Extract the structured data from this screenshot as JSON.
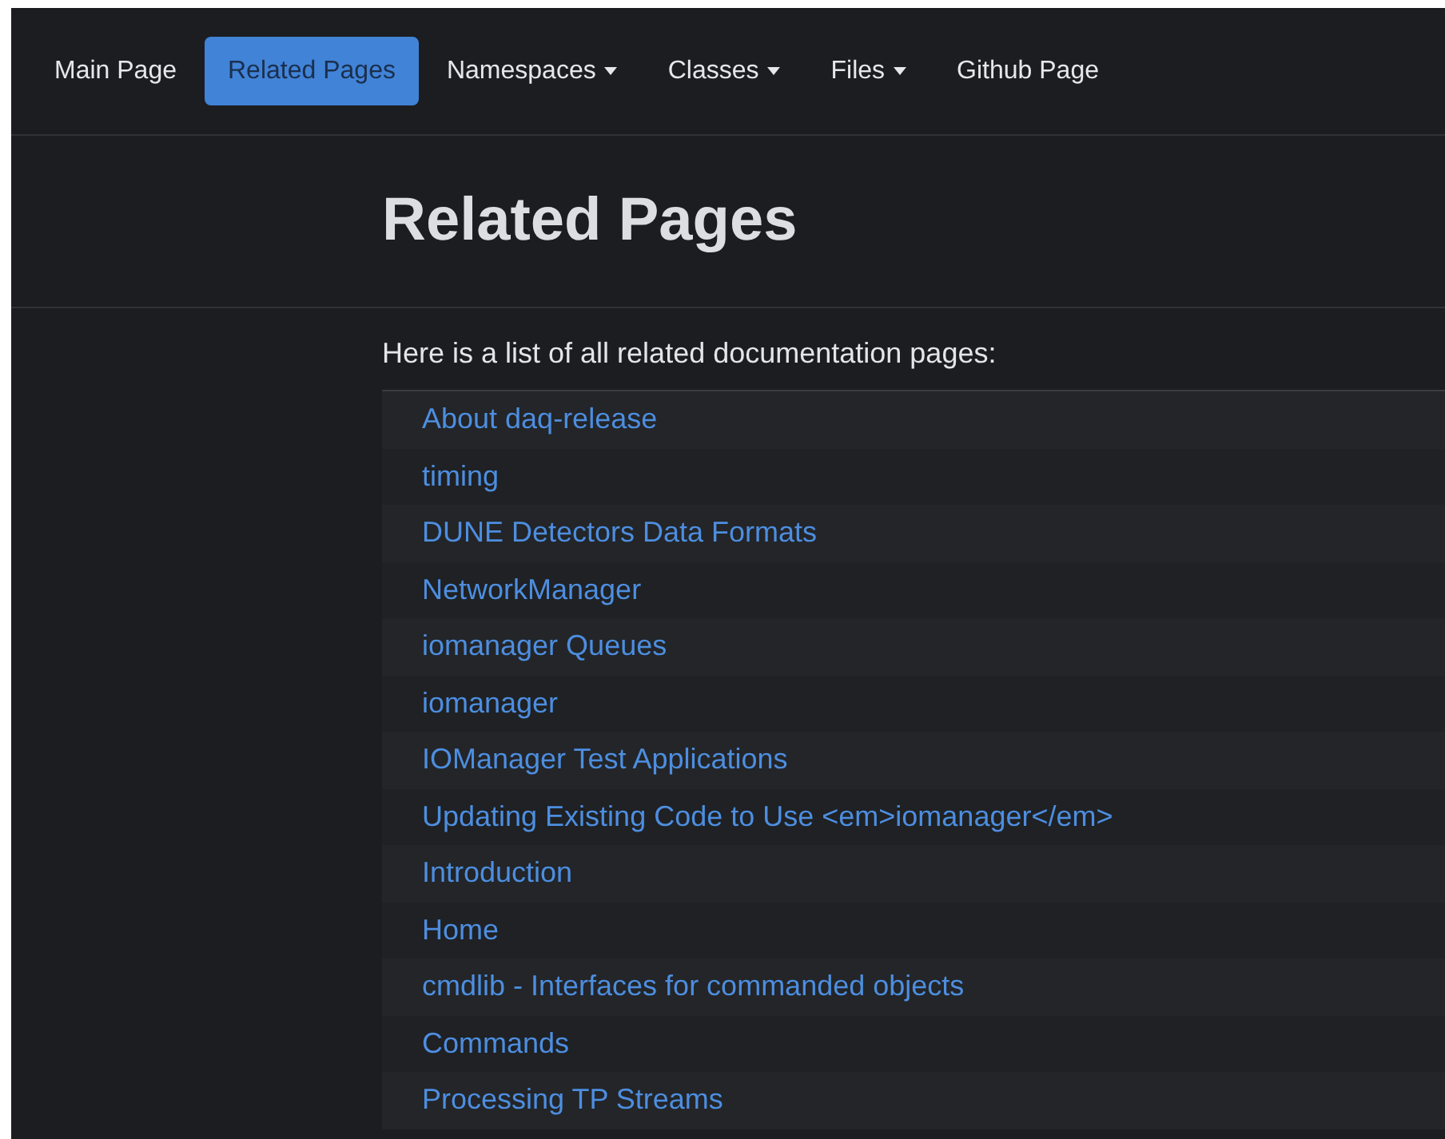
{
  "nav": [
    {
      "label": "Main Page",
      "selected": false,
      "dropdown": false
    },
    {
      "label": "Related Pages",
      "selected": true,
      "dropdown": false
    },
    {
      "label": "Namespaces",
      "selected": false,
      "dropdown": true
    },
    {
      "label": "Classes",
      "selected": false,
      "dropdown": true
    },
    {
      "label": "Files",
      "selected": false,
      "dropdown": true
    },
    {
      "label": "Github Page",
      "selected": false,
      "dropdown": false
    }
  ],
  "title": "Related Pages",
  "intro": "Here is a list of all related documentation pages:",
  "pages": [
    "About daq-release",
    "timing",
    "DUNE Detectors Data Formats",
    "NetworkManager",
    "iomanager Queues",
    "iomanager",
    "IOManager Test Applications",
    "Updating Existing Code to Use <em>iomanager</em>",
    "Introduction",
    "Home",
    "cmdlib - Interfaces for commanded objects",
    "Commands",
    "Processing TP Streams"
  ]
}
